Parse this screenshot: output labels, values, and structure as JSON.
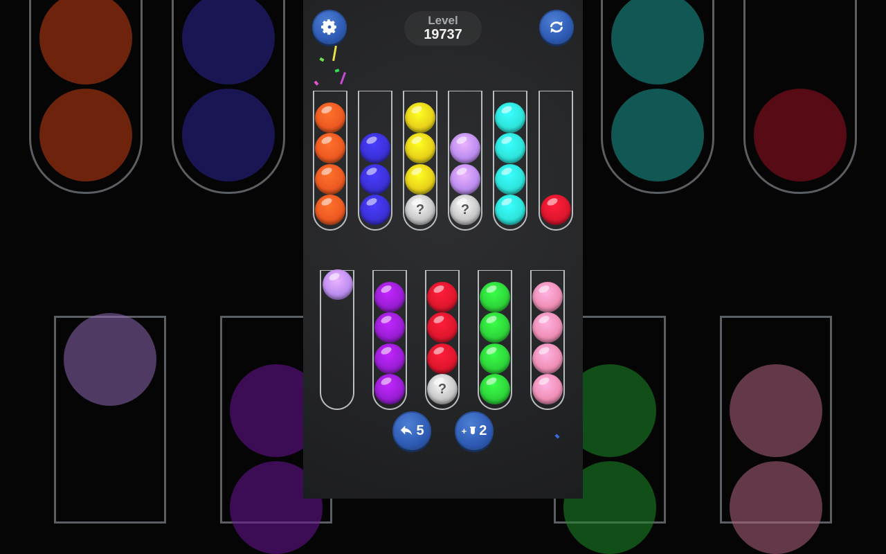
{
  "level": {
    "label": "Level",
    "number": "19737"
  },
  "colors": {
    "orange": "#ee5a22",
    "blue": "#3b31d8",
    "yellow": "#e8d21a",
    "lavender": "#bd8ef0",
    "cyan": "#2ee5dc",
    "red": "#e0172e",
    "purple": "#9b1ed6",
    "green": "#2ed63a",
    "pink": "#ef8fb6",
    "unknown": "#c8c8c8"
  },
  "tubes_top": [
    [
      "orange",
      "orange",
      "orange",
      "orange"
    ],
    [
      "blue",
      "blue",
      "blue"
    ],
    [
      "yellow",
      "yellow",
      "yellow",
      "unknown"
    ],
    [
      "lavender",
      "lavender",
      "unknown"
    ],
    [
      "cyan",
      "cyan",
      "cyan",
      "cyan"
    ],
    [
      "red"
    ]
  ],
  "tubes_bottom": [
    [],
    [
      "purple",
      "purple",
      "purple",
      "purple"
    ],
    [
      "red",
      "red",
      "red",
      "unknown"
    ],
    [
      "green",
      "green",
      "green",
      "green"
    ],
    [
      "pink",
      "pink",
      "pink",
      "pink"
    ]
  ],
  "lifted_ball": {
    "color": "lavender",
    "tube": "bottom-1"
  },
  "unknown_mark": "?",
  "buttons": {
    "settings_icon": "gear-icon",
    "restart_icon": "restart-arrows-icon",
    "undo_icon": "undo-arrow-icon",
    "undo_count": "5",
    "add_tube_icon": "add-tube-icon",
    "add_tube_prefix": "+",
    "add_tube_count": "2"
  }
}
